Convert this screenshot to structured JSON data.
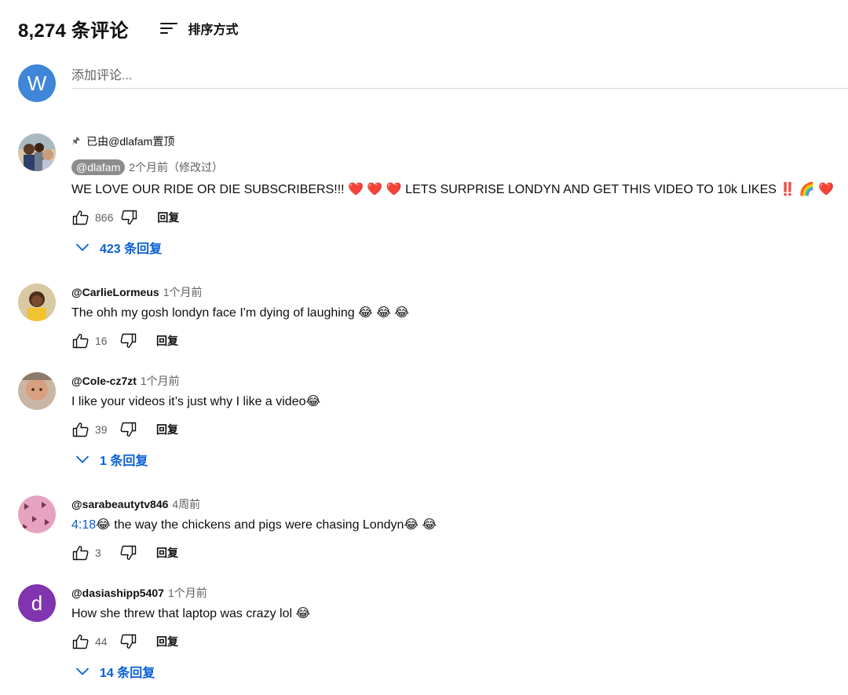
{
  "header": {
    "count": "8,274 条评论",
    "sort_label": "排序方式",
    "sort_icon": "sort-icon"
  },
  "add_comment": {
    "avatar_letter": "W",
    "avatar_color": "#3f86d8",
    "placeholder": "添加评论..."
  },
  "pinned_by": "已由@dlafam置顶",
  "reply_label": "回复",
  "accent": "#065fd4",
  "comments": [
    {
      "author": "@dlafam",
      "time": "2个月前（修改过）",
      "text": "WE LOVE OUR RIDE OR DIE SUBSCRIBERS!!! ❤️ ❤️ ❤️ LETS SURPRISE LONDYN AND GET THIS VIDEO TO 10k LIKES ‼️ 🌈 ❤️",
      "likes": "866",
      "replies": "423 条回复"
    },
    {
      "author": "@CarlieLormeus",
      "time": "1个月前",
      "text": "The ohh my gosh londyn face I'm dying of laughing 😂 😂 😂",
      "likes": "16"
    },
    {
      "author": "@Cole-cz7zt",
      "time": "1个月前",
      "text": "I like your videos it’s just why I like a video😂",
      "likes": "39",
      "replies": "1 条回复"
    },
    {
      "author": "@sarabeautytv846",
      "time": "4周前",
      "timestamp": "4:18",
      "text": "😂  the way the chickens and pigs were chasing Londyn😂 😂",
      "likes": "3"
    },
    {
      "author": "@dasiashipp5407",
      "time": "1个月前",
      "avatar_letter": "d",
      "avatar_color": "#8134af",
      "text": "How she threw that laptop was crazy lol 😂",
      "likes": "44",
      "replies": "14 条回复"
    }
  ]
}
